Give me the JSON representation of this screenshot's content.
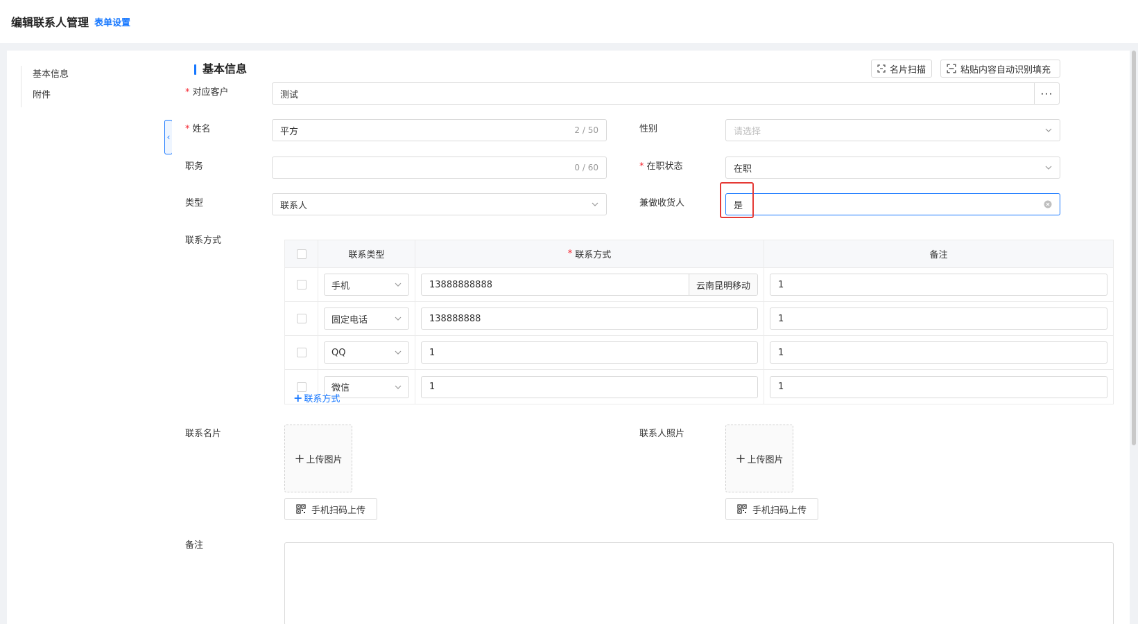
{
  "header": {
    "title": "编辑联系人管理",
    "form_settings": "表单设置"
  },
  "sidebar": {
    "items": [
      {
        "label": "基本信息"
      },
      {
        "label": "附件"
      }
    ]
  },
  "section": {
    "title": "基本信息"
  },
  "actions": {
    "card_scan": "名片扫描",
    "auto_fill": "粘贴内容自动识别填充"
  },
  "form": {
    "customer": {
      "label": "对应客户",
      "value": "测试"
    },
    "name": {
      "label": "姓名",
      "value": "平方",
      "count": "2 / 50"
    },
    "gender": {
      "label": "性别",
      "placeholder": "请选择"
    },
    "position": {
      "label": "职务",
      "value": "",
      "count": "0 / 60"
    },
    "employment": {
      "label": "在职状态",
      "value": "在职"
    },
    "type": {
      "label": "类型",
      "value": "联系人"
    },
    "consignee": {
      "label": "兼做收货人",
      "value": "是"
    },
    "contact_methods": {
      "label": "联系方式"
    },
    "business_card": {
      "label": "联系名片"
    },
    "photo": {
      "label": "联系人照片"
    },
    "remark": {
      "label": "备注"
    }
  },
  "contact_table": {
    "headers": {
      "type": "联系类型",
      "way": "联系方式",
      "note": "备注"
    },
    "rows": [
      {
        "type": "手机",
        "value": "13888888888",
        "suffix": "云南昆明移动",
        "note": "1"
      },
      {
        "type": "固定电话",
        "value": "138888888",
        "note": "1"
      },
      {
        "type": "QQ",
        "value": "1",
        "note": "1"
      },
      {
        "type": "微信",
        "value": "1",
        "note": "1"
      }
    ],
    "add_label": "联系方式"
  },
  "upload": {
    "label": "上传图片",
    "scan_upload": "手机扫码上传"
  },
  "colors": {
    "primary": "#1677ff",
    "required": "#f5222d",
    "highlight": "#e53935"
  }
}
